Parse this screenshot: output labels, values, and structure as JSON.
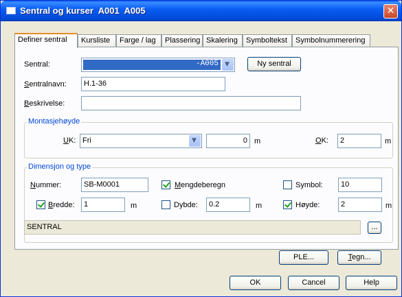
{
  "window": {
    "title": "Sentral og kurser  A001  A005",
    "close": "✕"
  },
  "tabs": [
    {
      "label": "Definer sentral",
      "active": true
    },
    {
      "label": "Kursliste"
    },
    {
      "label": "Farge / lag"
    },
    {
      "label": "Plassering"
    },
    {
      "label": "Skalering"
    },
    {
      "label": "Symboltekst"
    },
    {
      "label": "Symbolnummerering"
    }
  ],
  "form": {
    "sentral_label": "Sentral:",
    "sentral_value": "-A005",
    "ny_sentral": "Ny sentral",
    "sentralnavn_label_u": "S",
    "sentralnavn_label_rest": "entralnavn:",
    "sentralnavn_value": "H.1-36",
    "beskrivelse_label_u": "B",
    "beskrivelse_label_rest": "eskrivelse:",
    "beskrivelse_value": ""
  },
  "montasje": {
    "title": "Montasjehøyde",
    "uk_label_u": "U",
    "uk_label_rest": "K:",
    "uk_select": "Fri",
    "uk_value": "0",
    "uk_unit": "m",
    "ok_label_u": "O",
    "ok_label_rest": "K:",
    "ok_value": "2",
    "ok_unit": "m"
  },
  "dimensjon": {
    "title": "Dimensjon og type",
    "nummer_label_u": "N",
    "nummer_label_rest": "ummer:",
    "nummer_value": "SB-M0001",
    "mengde_label_u": "M",
    "mengde_label_rest": "engdeberegn",
    "mengde_checked": true,
    "symbol_label": "Symbol:",
    "symbol_checked": false,
    "symbol_value": "10",
    "bredde_label_u": "B",
    "bredde_label_rest": "redde:",
    "bredde_checked": true,
    "bredde_value": "1",
    "bredde_unit": "m",
    "dybde_label": "Dybde:",
    "dybde_checked": false,
    "dybde_value": "0.2",
    "dybde_unit": "m",
    "hoyde_label": "Høyde:",
    "hoyde_checked": true,
    "hoyde_value": "2",
    "hoyde_unit": "m",
    "type_value": "SENTRAL",
    "browse_label": "..."
  },
  "buttons": {
    "ple": "PLE...",
    "tegn_u": "T",
    "tegn_rest": "egn...",
    "ok": "OK",
    "cancel": "Cancel",
    "help": "Help"
  }
}
